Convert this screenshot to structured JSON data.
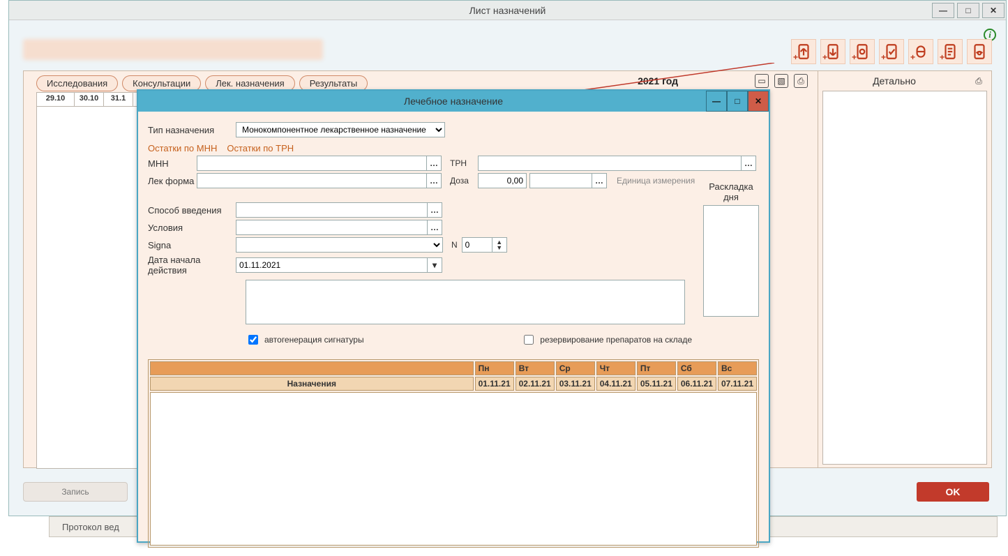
{
  "outer_window": {
    "title": "Лист назначений",
    "info_tooltip": "i"
  },
  "main": {
    "pills": [
      "Исследования",
      "Консультации",
      "Лек. назначения",
      "Результаты"
    ],
    "year_label": "2021 год",
    "date_headers": [
      "29.10",
      "30.10",
      "31.1"
    ],
    "side_label": "Детально",
    "record_btn": "Запись",
    "ok_btn": "OK"
  },
  "toolbar_icons": [
    "export-icon",
    "import-icon",
    "cert-icon",
    "check-icon",
    "med-icon",
    "note-icon",
    "view-icon"
  ],
  "outer_bottom": {
    "tab": "Протокол вед"
  },
  "dialog": {
    "title": "Лечебное назначение",
    "labels": {
      "type": "Тип назначения",
      "rem_mnn": "Остатки по МНН",
      "rem_trn": "Остатки по ТРН",
      "mnn": "МНН",
      "trn": "ТРН",
      "lekform": "Лек форма",
      "dose": "Доза",
      "unit": "Единица измерения",
      "route": "Способ введения",
      "cond": "Условия",
      "signa": "Signa",
      "n": "N",
      "startdate": "Дата начала действия",
      "dayplan": "Раскладка дня",
      "autogen": "автогенерация сигнатуры",
      "reserve": "резервирование препаратов на складе"
    },
    "values": {
      "type_selected": "Монокомпонентное лекарственное назначение",
      "mnn": "",
      "trn": "",
      "lekform": "",
      "dose": "0,00",
      "dose2": "",
      "route": "",
      "cond": "",
      "signa": "",
      "n": "0",
      "startdate": "01.11.2021",
      "autogen_checked": true,
      "reserve_checked": false
    },
    "schedule": {
      "days": [
        "Пн",
        "Вт",
        "Ср",
        "Чт",
        "Пт",
        "Сб",
        "Вс"
      ],
      "dates": [
        "01.11.21",
        "02.11.21",
        "03.11.21",
        "04.11.21",
        "05.11.21",
        "06.11.21",
        "07.11.21"
      ],
      "naz_label": "Назначения"
    }
  }
}
